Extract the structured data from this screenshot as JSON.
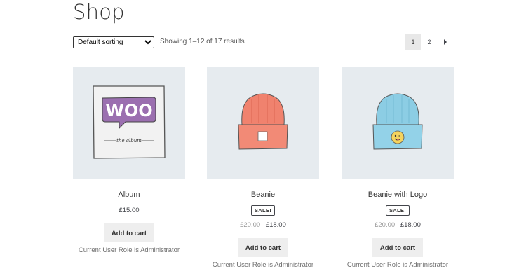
{
  "page": {
    "title": "Shop"
  },
  "toolbar": {
    "sort_selected": "Default sorting",
    "result_count": "Showing 1–12 of 17 results",
    "pagination": [
      "1",
      "2"
    ]
  },
  "products": [
    {
      "title": "Album",
      "sale_badge": "",
      "price_old": "",
      "price": "£15.00",
      "button": "Add to cart",
      "role_note": "Current User Role is Administrator"
    },
    {
      "title": "Beanie",
      "sale_badge": "SALE!",
      "price_old": "£20.00",
      "price": "£18.00",
      "button": "Add to cart",
      "role_note": "Current User Role is Administrator"
    },
    {
      "title": "Beanie with Logo",
      "sale_badge": "SALE!",
      "price_old": "£20.00",
      "price": "£18.00",
      "button": "Add to cart",
      "role_note": "Current User Role is Administrator"
    }
  ],
  "images": {
    "album": {
      "logo_text": "WOO",
      "subtitle": "the album",
      "logo_color": "#9b6fb0"
    },
    "beanie_color": "#f0826e",
    "beanie_logo_color": "#8ccde4",
    "emoji_color": "#f4d35e"
  },
  "icons": {
    "next_page": "chevron-right-icon"
  },
  "colors": {
    "image_bg": "#e6ebef",
    "button_bg": "#eeeeee",
    "current_page_bg": "#e8e8e8"
  }
}
